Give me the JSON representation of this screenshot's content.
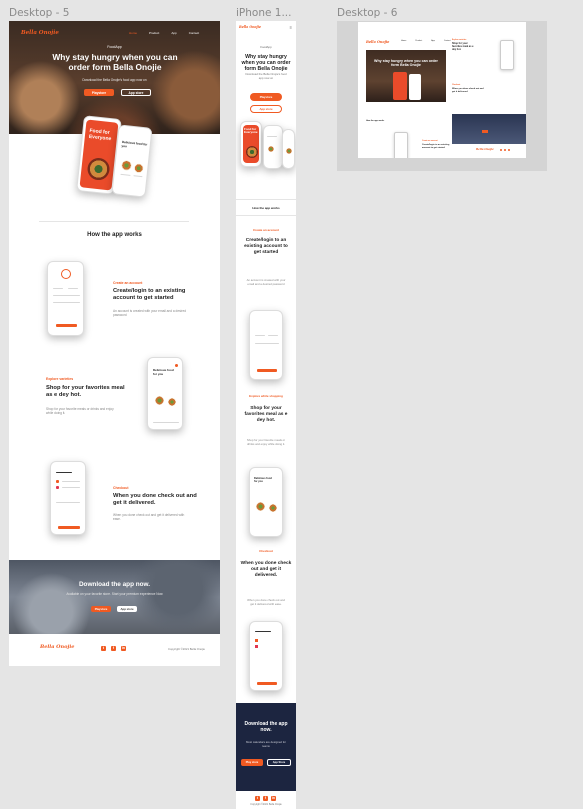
{
  "frames": {
    "desktop5": "Desktop - 5",
    "iphone": "iPhone 1...",
    "desktop6": "Desktop - 6"
  },
  "brand": {
    "logo": "Bella Onojie",
    "accent": "#f05a22",
    "dark": "#1c2540"
  },
  "nav": [
    "Home",
    "Product",
    "App",
    "Contact"
  ],
  "hero": {
    "tag": "FoodApp",
    "title": "Why stay hungry when you can order form Bella Onojie",
    "subtitle": "Download the Bella Onojie's food app now on",
    "btn_primary": "Playstore",
    "btn_secondary": "App store"
  },
  "phone_screen": {
    "headline": "Food for Everyone",
    "welcome": "Delicious food for you"
  },
  "how": {
    "title": "How the app works"
  },
  "steps": [
    {
      "kicker": "Create an account",
      "title": "Create/login to an existing account to get started",
      "body": "An account is created with your email and a desired password"
    },
    {
      "kicker": "Explore varieties",
      "title": "Shop for your favorites meal as e dey hot.",
      "body": "Shop for your favorite meals or drinks and enjoy while doing it."
    },
    {
      "kicker": "Checkout",
      "title": "When you done check out and get it delivered.",
      "body": "When you done check out and get it delivered with ease."
    }
  ],
  "mobile_steps": [
    {
      "kicker": "Create an account",
      "title": "Create/login to an existing account to get started",
      "body": "An account is created with your email and a desired password"
    },
    {
      "kicker": "Explore while shopping",
      "title": "Shop for your favorites meal as e dey hot.",
      "body": "Shop for your favorite meals or drinks and enjoy while doing it."
    },
    {
      "kicker": "Checkout",
      "title": "When you done check out and get it delivered.",
      "body": "When you done check out and get it delivered with ease."
    }
  ],
  "download": {
    "title": "Download the app now.",
    "body": "Available on your favorite store. Start your premium experience Now",
    "mobile_body": "Most calendars are designed for teams",
    "btn_primary": "Playstore",
    "btn_secondary": "App store",
    "btn_primary_m": "Play store",
    "btn_secondary_m": "App Store"
  },
  "footer": {
    "copyright": "Copyright ©2021 Bella Onojie",
    "social": [
      "t",
      "f",
      "in"
    ]
  },
  "desktop6": {
    "hero_title": "Why stay hungry when you can order form Bella Onojie",
    "right_title": "Shop for your favorites meal as e dey hot.",
    "right_title2": "When you done check out and get it delivered.",
    "how": "How the app works",
    "bottom_title": "Create/login to an existing account to get started",
    "kicker": "Create an account"
  }
}
